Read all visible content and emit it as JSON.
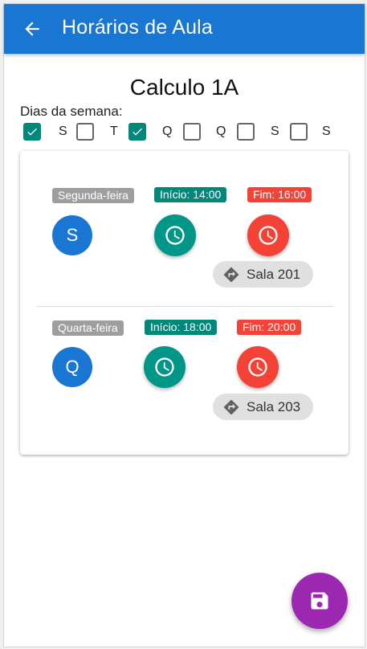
{
  "app": {
    "title": "Horários de Aula",
    "primary_color": "#1976d2",
    "back_icon": "arrow-back-icon"
  },
  "course": {
    "name": "Calculo 1A"
  },
  "days": {
    "label": "Dias da semana:",
    "items": [
      {
        "letter": "S",
        "checked": true
      },
      {
        "letter": "T",
        "checked": false
      },
      {
        "letter": "Q",
        "checked": true
      },
      {
        "letter": "Q",
        "checked": false
      },
      {
        "letter": "S",
        "checked": false
      },
      {
        "letter": "S",
        "checked": false
      }
    ]
  },
  "schedule": [
    {
      "day_name": "Segunda-feira",
      "day_initial": "S",
      "start": "Início: 14:00",
      "end": "Fim: 16:00",
      "room": "Sala 201"
    },
    {
      "day_name": "Quarta-feira",
      "day_initial": "Q",
      "start": "Início: 18:00",
      "end": "Fim: 20:00",
      "room": "Sala 203"
    }
  ],
  "colors": {
    "checkbox_checked": "#00897b",
    "start_chip": "#00897b",
    "end_chip": "#f44336",
    "save_fab": "#9c27b0"
  },
  "save_icon": "save-icon"
}
